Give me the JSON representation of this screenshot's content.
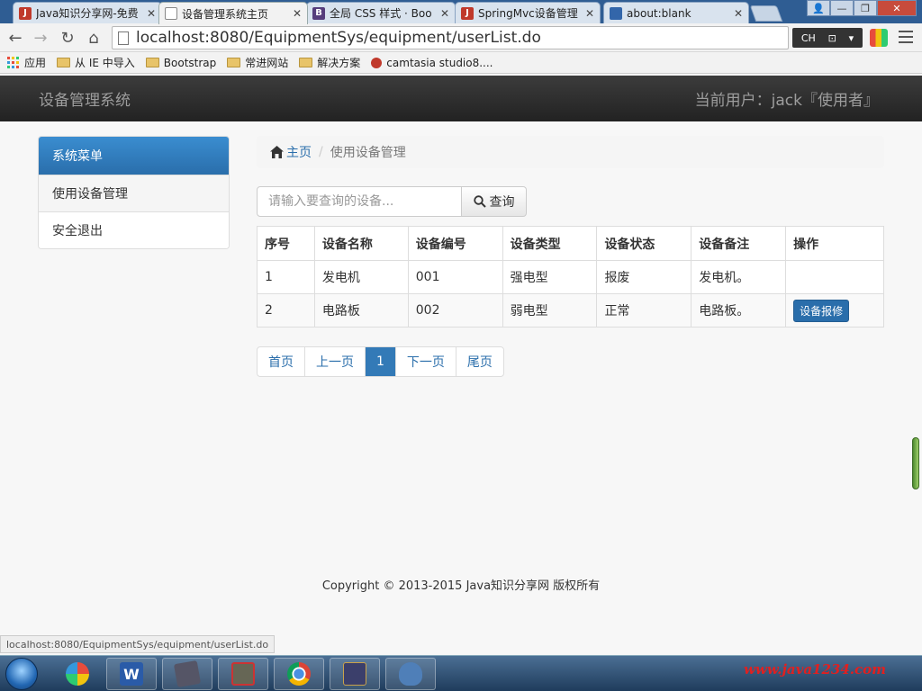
{
  "browser": {
    "tabs": [
      {
        "title": "Java知识分享网-免费",
        "favicon": "J",
        "favicon_color": "#c0392b"
      },
      {
        "title": "设备管理系统主页",
        "favicon": "",
        "favicon_color": "#888888"
      },
      {
        "title": "全局 CSS 样式 · Boo",
        "favicon": "B",
        "favicon_color": "#563d7c"
      },
      {
        "title": "SpringMvc设备管理",
        "favicon": "J",
        "favicon_color": "#c0392b"
      },
      {
        "title": "about:blank",
        "favicon": "",
        "favicon_color": "#3366aa"
      }
    ],
    "url": "localhost:8080/EquipmentSys/equipment/userList.do",
    "ime_label": "CH",
    "bookmarks": [
      {
        "label": "应用",
        "icon": "apps-icon"
      },
      {
        "label": "从 IE 中导入",
        "icon": "folder-icon"
      },
      {
        "label": "Bootstrap",
        "icon": "folder-icon"
      },
      {
        "label": "常进网站",
        "icon": "folder-icon"
      },
      {
        "label": "解决方案",
        "icon": "folder-icon"
      },
      {
        "label": "camtasia studio8....",
        "icon": "camtasia-icon"
      }
    ],
    "status_url": "localhost:8080/EquipmentSys/equipment/userList.do"
  },
  "app": {
    "brand": "设备管理系统",
    "current_user": "当前用户：jack『使用者』"
  },
  "sidebar": {
    "heading": "系统菜单",
    "items": [
      {
        "label": "使用设备管理"
      },
      {
        "label": "安全退出"
      }
    ]
  },
  "breadcrumb": {
    "home": "主页",
    "current": "使用设备管理"
  },
  "search": {
    "placeholder": "请输入要查询的设备...",
    "button": "查询"
  },
  "table": {
    "headers": [
      "序号",
      "设备名称",
      "设备编号",
      "设备类型",
      "设备状态",
      "设备备注",
      "操作"
    ],
    "rows": [
      {
        "no": "1",
        "name": "发电机",
        "code": "001",
        "type": "强电型",
        "status": "报废",
        "remark": "发电机。",
        "action": ""
      },
      {
        "no": "2",
        "name": "电路板",
        "code": "002",
        "type": "弱电型",
        "status": "正常",
        "remark": "电路板。",
        "action": "设备报修"
      }
    ]
  },
  "pagination": {
    "first": "首页",
    "prev": "上一页",
    "current": "1",
    "next": "下一页",
    "last": "尾页"
  },
  "footer": "Copyright © 2013-2015 Java知识分享网 版权所有",
  "watermark": "www.java1234.com",
  "colors": {
    "primary": "#337ab7",
    "navbar": "#222222",
    "link": "#2a6eab"
  }
}
